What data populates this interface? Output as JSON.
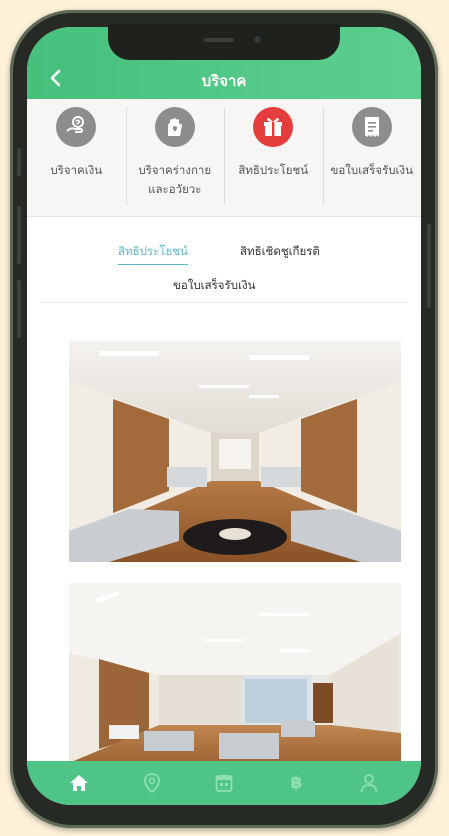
{
  "header": {
    "title": "บริจาค",
    "back_icon": "chevron-left-icon"
  },
  "menu": {
    "items": [
      {
        "label": "บริจาคเงิน",
        "icon": "money-hand-icon",
        "active": false
      },
      {
        "label": "บริจาคร่างกาย และอวัยวะ",
        "icon": "hand-heart-icon",
        "active": false
      },
      {
        "label": "สิทธิประโยชน์",
        "icon": "gift-icon",
        "active": true
      },
      {
        "label": "ขอใบเสร็จรับเงิน",
        "icon": "receipt-icon",
        "active": false
      }
    ]
  },
  "tabs": [
    {
      "label": "สิทธิประโยชน์",
      "active": true
    },
    {
      "label": "สิทธิเชิดชูเกียรติ",
      "active": false
    },
    {
      "label": "ขอใบเสร็จรับเงิน",
      "active": false
    }
  ],
  "bottom_nav": {
    "items": [
      {
        "icon": "home-icon",
        "active": true
      },
      {
        "icon": "location-pin-icon",
        "active": false
      },
      {
        "icon": "calendar-icon",
        "active": false
      },
      {
        "icon": "baht-icon",
        "text": "฿",
        "active": false
      },
      {
        "icon": "user-icon",
        "active": false
      }
    ]
  },
  "colors": {
    "primary_green": "#4ec487",
    "active_tab": "#5fb7c9",
    "gift_red": "#e53c3c",
    "page_bg": "#fdf1d8"
  }
}
